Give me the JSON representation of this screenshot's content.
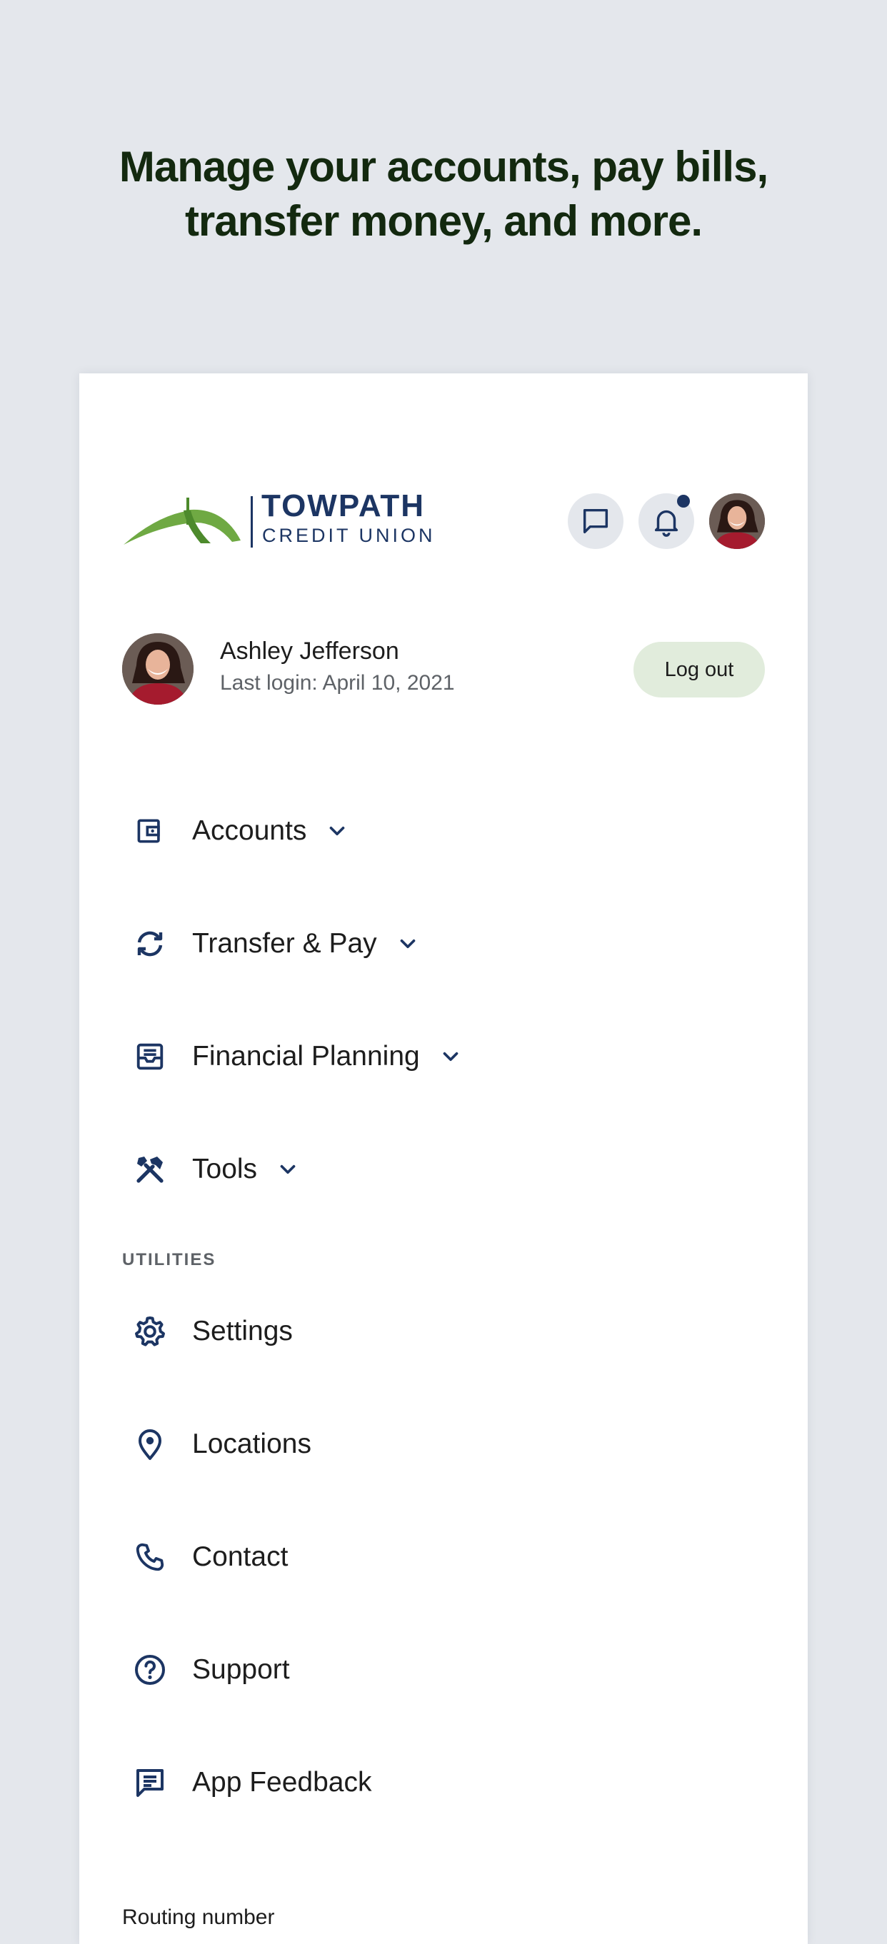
{
  "headline": {
    "line1": "Manage your accounts, pay bills,",
    "line2": "transfer money, and more."
  },
  "brand": {
    "name_line1": "TOWPATH",
    "name_line2": "CREDIT UNION",
    "primary_color": "#1c3563",
    "accent_color": "#6fa943"
  },
  "header_actions": [
    {
      "icon": "chat-icon"
    },
    {
      "icon": "bell-icon",
      "has_notification": true
    },
    {
      "icon": "avatar"
    }
  ],
  "user": {
    "name": "Ashley Jefferson",
    "last_login": "Last login: April 10, 2021",
    "logout_label": "Log out"
  },
  "nav": {
    "main": [
      {
        "label": "Accounts",
        "icon": "wallet-icon",
        "expandable": true
      },
      {
        "label": "Transfer & Pay",
        "icon": "sync-icon",
        "expandable": true
      },
      {
        "label": "Financial Planning",
        "icon": "inbox-icon",
        "expandable": true
      },
      {
        "label": "Tools",
        "icon": "tools-icon",
        "expandable": true
      }
    ],
    "utilities_heading": "UTILITIES",
    "utilities": [
      {
        "label": "Settings",
        "icon": "gear-icon"
      },
      {
        "label": "Locations",
        "icon": "location-pin-icon"
      },
      {
        "label": "Contact",
        "icon": "phone-icon"
      },
      {
        "label": "Support",
        "icon": "help-circle-icon"
      },
      {
        "label": "App Feedback",
        "icon": "feedback-icon"
      }
    ]
  },
  "footer": {
    "routing_label": "Routing number"
  }
}
